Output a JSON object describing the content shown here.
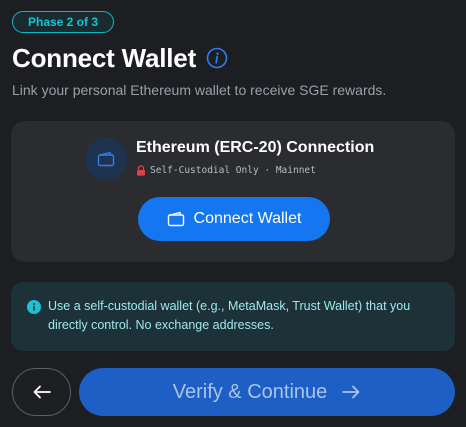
{
  "header": {
    "phase_label": "Phase 2 of 3",
    "title": "Connect Wallet",
    "subtitle": "Link your personal Ethereum wallet to receive SGE rewards."
  },
  "wallet_card": {
    "title": "Ethereum (ERC-20) Connection",
    "meta": "Self-Custodial Only · Mainnet",
    "connect_label": "Connect Wallet"
  },
  "notice": {
    "text": "Use a self-custodial wallet (e.g., MetaMask, Trust Wallet) that you directly control. No exchange addresses."
  },
  "footer": {
    "continue_label": "Verify & Continue",
    "continue_enabled": false
  },
  "colors": {
    "background": "#1c1e21",
    "accent_teal": "#14c2d4",
    "primary_blue": "#1476f0",
    "lock_red": "#e0404a"
  },
  "icons": {
    "info": "info-circle-icon",
    "wallet": "wallet-icon",
    "lock": "lock-icon",
    "back": "arrow-left-icon",
    "forward": "arrow-right-icon"
  }
}
